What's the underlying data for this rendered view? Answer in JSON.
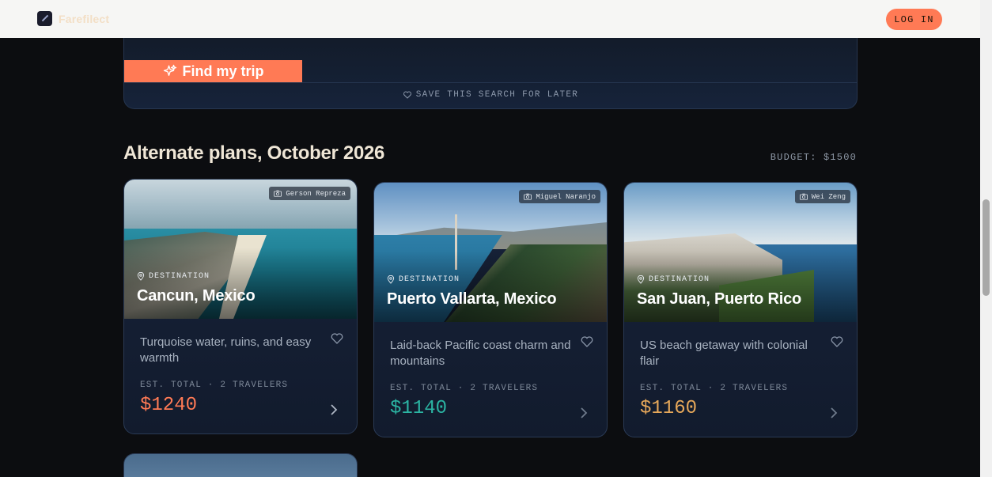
{
  "nav": {
    "brand": "Farefilect",
    "login_label": "LOG IN"
  },
  "search": {
    "find_label": "Find my trip",
    "save_label": "SAVE THIS SEARCH FOR LATER"
  },
  "section": {
    "title": "Alternate plans, October 2026",
    "budget": "BUDGET: $1500"
  },
  "cards": [
    {
      "credit": "Gerson Repreza",
      "dest_label": "DESTINATION",
      "name": "Cancun, Mexico",
      "description": "Turquoise water, ruins, and easy warmth",
      "est": "EST. TOTAL · 2 TRAVELERS",
      "price": "$1240",
      "price_color": "#ff7a55"
    },
    {
      "credit": "Miguel Naranjo",
      "dest_label": "DESTINATION",
      "name": "Puerto Vallarta, Mexico",
      "description": "Laid-back Pacific coast charm and mountains",
      "est": "EST. TOTAL · 2 TRAVELERS",
      "price": "$1140",
      "price_color": "#2bb5a3"
    },
    {
      "credit": "Wei Zeng",
      "dest_label": "DESTINATION",
      "name": "San Juan, Puerto Rico",
      "description": "US beach getaway with colonial flair",
      "est": "EST. TOTAL · 2 TRAVELERS",
      "price": "$1160",
      "price_color": "#e6a85a"
    }
  ],
  "icons": {
    "find": "sparkle-icon",
    "save": "heart-icon",
    "credit": "camera-icon",
    "destination": "map-pin-icon",
    "favorite": "heart-icon",
    "open": "chevron-right-icon"
  }
}
